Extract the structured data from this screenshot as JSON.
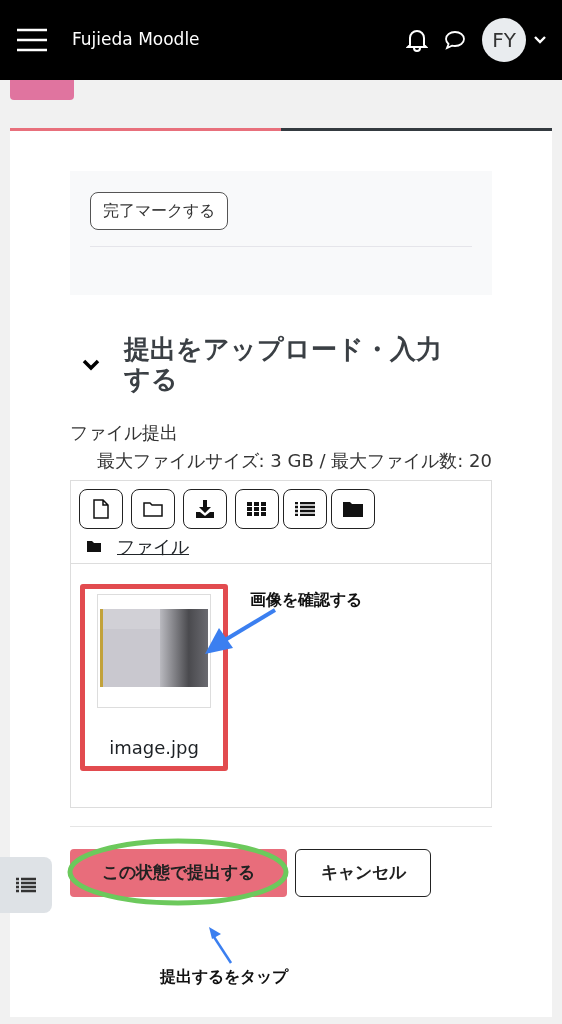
{
  "navbar": {
    "brand": "Fujieda Moodle",
    "avatar": "FY"
  },
  "completion": {
    "button": "完了マークする"
  },
  "section": {
    "heading": "提出をアップロード・入力する",
    "expanded": true
  },
  "file_submission": {
    "label": "ファイル提出",
    "limits": "最大ファイルサイズ: 3 GB / 最大ファイル数: 20",
    "path": "ファイル",
    "files": [
      {
        "name": "image.jpg",
        "kind": "picture"
      }
    ]
  },
  "annotations": [
    {
      "text": "画像を確認する"
    },
    {
      "text": "提出するをタップ"
    }
  ],
  "buttons": [
    {
      "label": "この状態で提出する",
      "kind": "primary"
    },
    {
      "label": "キャンセル",
      "kind": "secondary"
    }
  ]
}
